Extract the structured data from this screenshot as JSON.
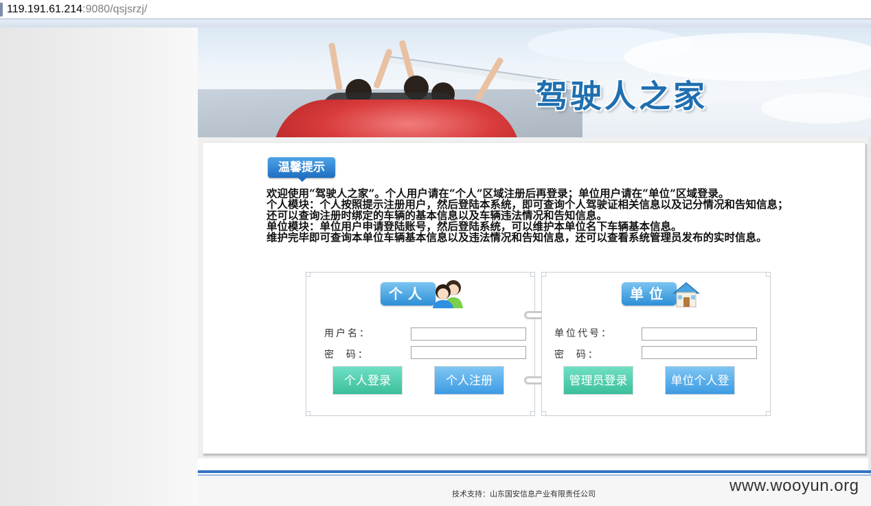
{
  "browser": {
    "url_host": "119.191.61.214",
    "url_rest": ":9080/qsjsrzj/"
  },
  "banner": {
    "title": "驾驶人之家"
  },
  "tips": {
    "badge": "温馨提示",
    "lines": [
      "欢迎使用“驾驶人之家”。个人用户请在“个人”区域注册后再登录；单位用户请在“单位”区域登录。",
      "个人模块：个人按照提示注册用户，然后登陆本系统，即可查询个人驾驶证相关信息以及记分情况和告知信息；",
      "还可以查询注册时绑定的车辆的基本信息以及车辆违法情况和告知信息。",
      "单位模块：单位用户申请登陆账号，然后登陆系统，可以维护本单位名下车辆基本信息。",
      "维护完毕即可查询本单位车辆基本信息以及违法情况和告知信息，还可以查看系统管理员发布的实时信息。"
    ]
  },
  "personal": {
    "heading": "个人",
    "username_label": "用户名：",
    "password_label": "密  码：",
    "login_button": "个人登录",
    "register_button": "个人注册"
  },
  "unit": {
    "heading": "单位",
    "code_label": "单位代号：",
    "password_label": "密  码：",
    "admin_login_button": "管理员登录",
    "unit_personal_login_button": "单位个人登录"
  },
  "footer": {
    "support": "技术支持：山东国安信息产业有限责任公司"
  },
  "watermark": "www.wooyun.org",
  "colors": {
    "accent_blue": "#2b8fd6",
    "button_green": "#3cbf9c",
    "button_blue": "#3d9be3",
    "footer_line": "#3573c3"
  }
}
